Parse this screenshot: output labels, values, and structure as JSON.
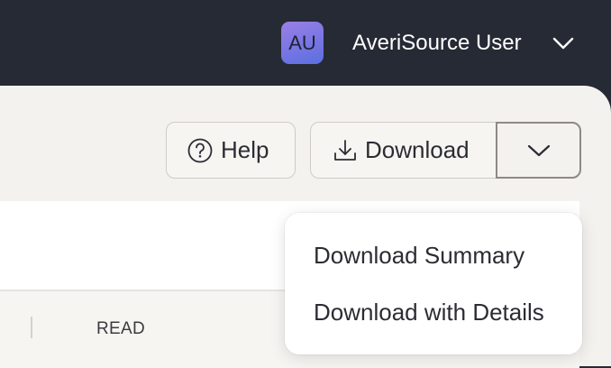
{
  "user": {
    "initials": "AU",
    "name": "AveriSource User"
  },
  "toolbar": {
    "help_label": "Help",
    "download_label": "Download"
  },
  "table": {
    "columns": [
      "READ"
    ]
  },
  "download_menu": {
    "items": [
      "Download Summary",
      "Download with Details"
    ]
  },
  "colors": {
    "topbar": "#262a35",
    "panel": "#f3f2ef",
    "avatar_gradient_start": "#9b7fe6",
    "avatar_gradient_end": "#5a6fe0"
  }
}
